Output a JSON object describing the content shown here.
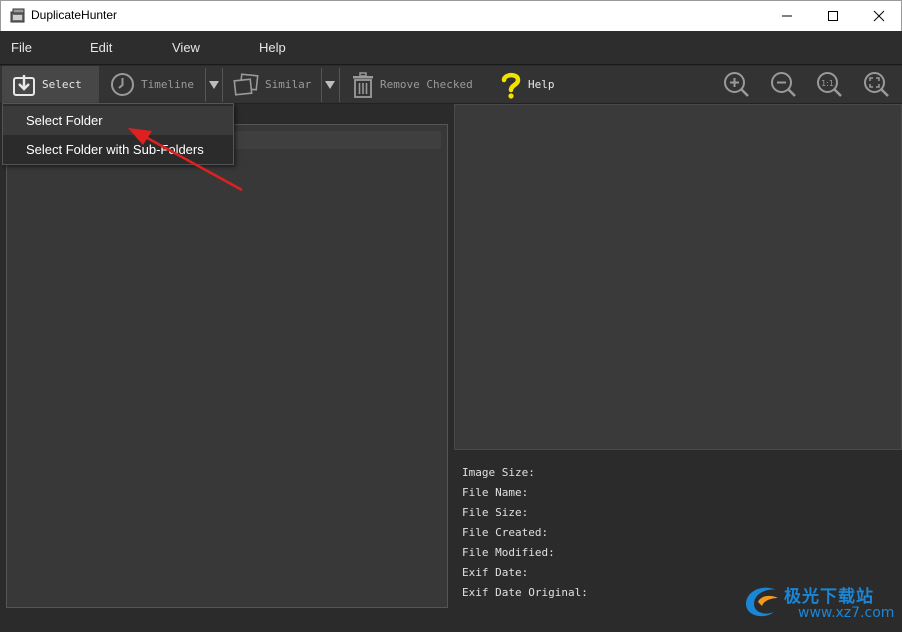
{
  "window": {
    "title": "DuplicateHunter",
    "minimize_icon": "minimize-icon",
    "maximize_icon": "maximize-icon",
    "close_icon": "close-icon"
  },
  "menu": {
    "items": [
      {
        "label": "File"
      },
      {
        "label": "Edit"
      },
      {
        "label": "View"
      },
      {
        "label": "Help"
      }
    ]
  },
  "toolbar": {
    "select_label": "Select",
    "timeline_label": "Timeline",
    "similar_label": "Similar",
    "remove_label": "Remove Checked",
    "help_label": "Help",
    "zoom_in_icon": "zoom-in-icon",
    "zoom_out_icon": "zoom-out-icon",
    "actual_size_icon": "actual-size-icon",
    "fit_icon": "fit-screen-icon"
  },
  "dropdown": {
    "items": [
      {
        "label": "Select Folder"
      },
      {
        "label": "Select Folder with Sub-Folders"
      }
    ]
  },
  "info": {
    "image_size": "Image Size:",
    "file_name": "File Name:",
    "file_size": "File Size:",
    "file_created": "File Created:",
    "file_modified": "File Modified:",
    "exif_date": "Exif Date:",
    "exif_date_original": "Exif Date Original:"
  },
  "watermark": {
    "text": "极光下载站",
    "url": "www.xz7.com"
  },
  "colors": {
    "accent_arrow": "#e02020",
    "help_icon": "#f2e200",
    "watermark": "#1b86d6"
  }
}
